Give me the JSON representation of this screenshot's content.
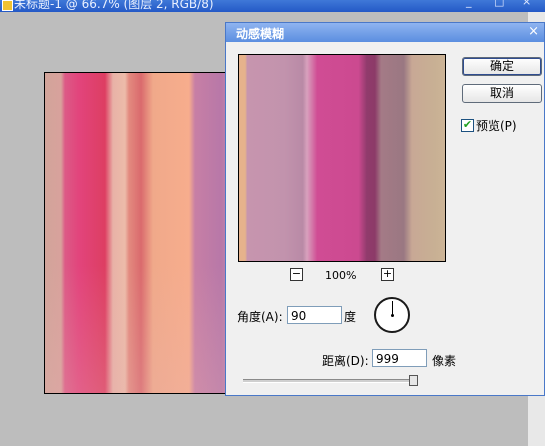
{
  "document": {
    "title": "未标题-1 @ 66.7% (图层 2, RGB/8)",
    "controls": [
      "_",
      "□",
      "×"
    ]
  },
  "dialog": {
    "title": "动感模糊",
    "close": "×",
    "ok_label": "确定",
    "cancel_label": "取消",
    "preview_label": "预览(P)",
    "preview_checked": true,
    "check_mark": "✔",
    "zoom_out": "−",
    "zoom_in": "+",
    "zoom_level": "100%",
    "angle_label": "角度(A):",
    "angle_value": "90",
    "angle_unit": "度",
    "distance_label": "距离(D):",
    "distance_value": "999",
    "distance_unit": "像素",
    "distance_slider_fraction": 1.0
  },
  "colors": {
    "titlebar": "#2459c6",
    "dialog_titlebar": "#5b8ee0",
    "dialog_bg": "#f0f0f0",
    "workspace_bg": "#bdbdbd"
  }
}
